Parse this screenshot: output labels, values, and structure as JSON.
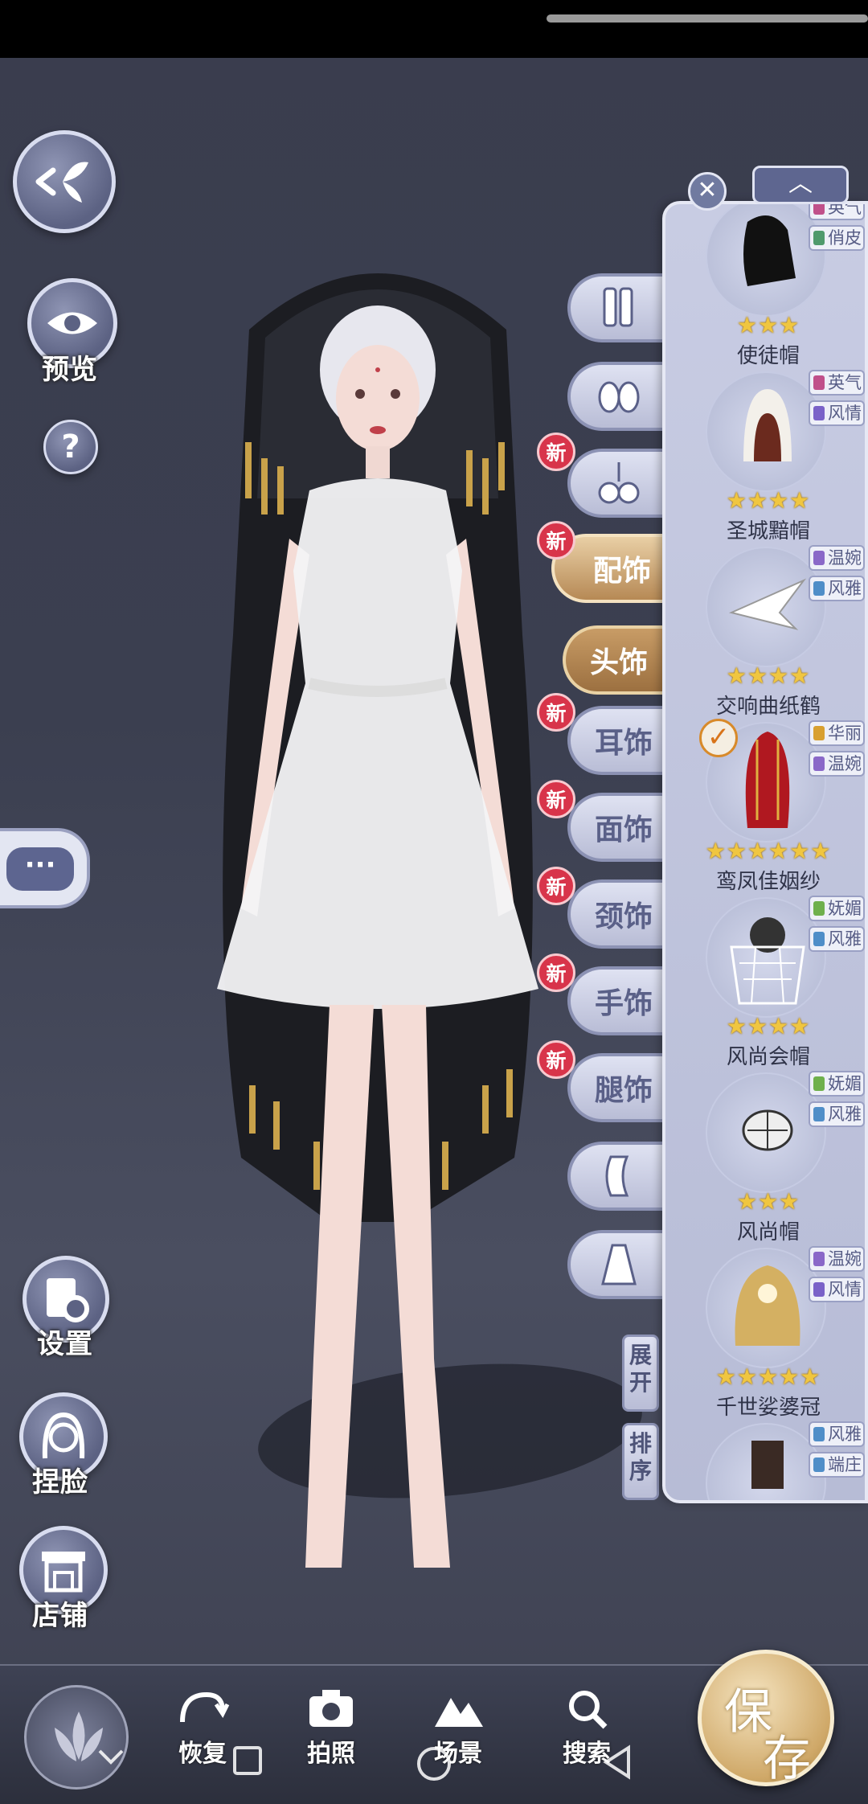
{
  "left_controls": {
    "preview_label": "预览",
    "help_icon_text": "?",
    "settings_label": "设置",
    "face_label": "捏脸",
    "shop_label": "店铺",
    "chat_icon_text": "···"
  },
  "categories": {
    "peishi": "配饰",
    "toushi": "头饰",
    "ershi": "耳饰",
    "mianshi": "面饰",
    "jingshi": "颈饰",
    "shoushi": "手饰",
    "tuishi": "腿饰",
    "new_badge": "新"
  },
  "side_buttons": {
    "expand": "展开",
    "sort": "排序"
  },
  "panel": {
    "close_icon": "✕",
    "up_icon": "︿",
    "items": [
      {
        "name": "使徒帽",
        "stars": "★★★",
        "tags": [
          {
            "text": "英气",
            "color": "#c0508a"
          },
          {
            "text": "俏皮",
            "color": "#4f9a6c"
          }
        ]
      },
      {
        "name": "圣城黯帽",
        "stars": "★★★★",
        "tags": [
          {
            "text": "英气",
            "color": "#c0508a"
          },
          {
            "text": "风情",
            "color": "#7a62c8"
          }
        ]
      },
      {
        "name": "交响曲纸鹤",
        "stars": "★★★★",
        "tags": [
          {
            "text": "温婉",
            "color": "#8a68c8"
          },
          {
            "text": "风雅",
            "color": "#4f8ec8"
          }
        ]
      },
      {
        "name": "鸾凤佳姻纱",
        "stars": "★★★★★★",
        "tags": [
          {
            "text": "华丽",
            "color": "#d8a030"
          },
          {
            "text": "温婉",
            "color": "#8a68c8"
          }
        ],
        "selected_mark": "✓"
      },
      {
        "name": "风尚会帽",
        "stars": "★★★★",
        "tags": [
          {
            "text": "妩媚",
            "color": "#6fb04c"
          },
          {
            "text": "风雅",
            "color": "#4f8ec8"
          }
        ]
      },
      {
        "name": "风尚帽",
        "stars": "★★★",
        "tags": [
          {
            "text": "妩媚",
            "color": "#6fb04c"
          },
          {
            "text": "风雅",
            "color": "#4f8ec8"
          }
        ]
      },
      {
        "name": "千世娑婆冠",
        "stars": "★★★★★",
        "tags": [
          {
            "text": "温婉",
            "color": "#8a68c8"
          },
          {
            "text": "风情",
            "color": "#7a62c8"
          }
        ]
      },
      {
        "name": "",
        "stars": "",
        "tags": [
          {
            "text": "风雅",
            "color": "#4f8ec8"
          },
          {
            "text": "端庄",
            "color": "#4f8ec8"
          }
        ]
      }
    ]
  },
  "bottombar": {
    "restore": "恢复",
    "photo": "拍照",
    "scene": "场景",
    "search": "搜索",
    "save_char1": "保",
    "save_char2": "存"
  }
}
